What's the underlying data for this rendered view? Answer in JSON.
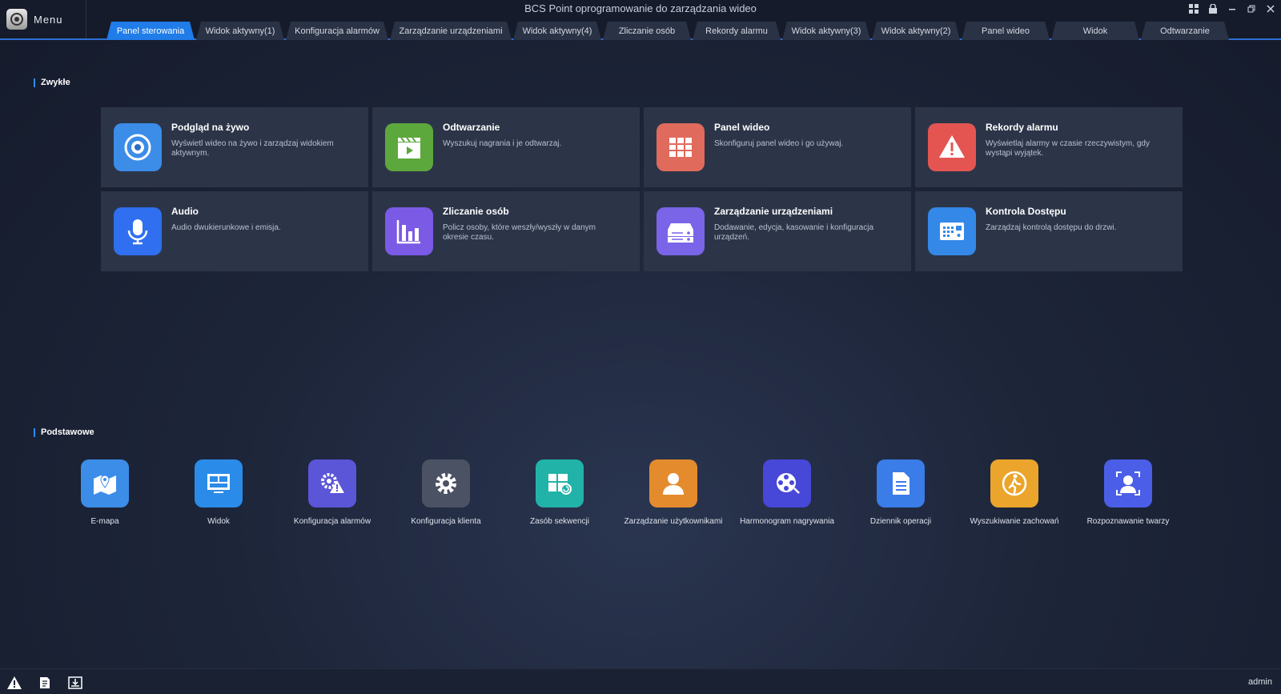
{
  "window": {
    "title": "BCS Point oprogramowanie do zarządzania wideo",
    "menu_label": "Menu",
    "controls": [
      "layout-icon",
      "lock-icon",
      "minimize-icon",
      "restore-icon",
      "close-icon"
    ]
  },
  "tabs": [
    {
      "label": "Panel sterowania",
      "active": true
    },
    {
      "label": "Widok aktywny(1)"
    },
    {
      "label": "Konfiguracja alarmów"
    },
    {
      "label": "Zarządzanie urządzeniami"
    },
    {
      "label": "Widok aktywny(4)"
    },
    {
      "label": "Zliczanie osób"
    },
    {
      "label": "Rekordy alarmu"
    },
    {
      "label": "Widok aktywny(3)"
    },
    {
      "label": "Widok aktywny(2)"
    },
    {
      "label": "Panel wideo"
    },
    {
      "label": "Widok"
    },
    {
      "label": "Odtwarzanie"
    }
  ],
  "common": {
    "title": "Zwykłe",
    "cards": [
      {
        "title": "Podgląd na żywo",
        "desc": "Wyświetl wideo na żywo i zarządzaj widokiem aktywnym.",
        "icon": "camera-icon",
        "color": "#3b8de8"
      },
      {
        "title": "Odtwarzanie",
        "desc": "Wyszukuj nagrania i je odtwarzaj.",
        "icon": "clapper-icon",
        "color": "#5da83d"
      },
      {
        "title": "Panel wideo",
        "desc": "Skonfiguruj panel wideo i go używaj.",
        "icon": "video-wall-icon",
        "color": "#e06a5c"
      },
      {
        "title": "Rekordy alarmu",
        "desc": "Wyświetlaj alarmy w czasie rzeczywistym, gdy wystąpi wyjątek.",
        "icon": "warning-icon",
        "color": "#e45552"
      },
      {
        "title": "Audio",
        "desc": "Audio dwukierunkowe i emisja.",
        "icon": "microphone-icon",
        "color": "#2f6ff0"
      },
      {
        "title": "Zliczanie osób",
        "desc": "Policz osoby, które weszły/wyszły w danym okresie czasu.",
        "icon": "bar-chart-icon",
        "color": "#7b5ae6"
      },
      {
        "title": "Zarządzanie urządzeniami",
        "desc": "Dodawanie, edycja, kasowanie i konfiguracja urządzeń.",
        "icon": "device-icon",
        "color": "#7a64e8"
      },
      {
        "title": "Kontrola Dostępu",
        "desc": "Zarządzaj kontrolą dostępu do drzwi.",
        "icon": "access-control-icon",
        "color": "#3488e8"
      }
    ]
  },
  "basic": {
    "title": "Podstawowe",
    "items": [
      {
        "label": "E-mapa",
        "icon": "map-icon",
        "color": "#3b8de8"
      },
      {
        "label": "Widok",
        "icon": "monitor-icon",
        "color": "#2a8be8"
      },
      {
        "label": "Konfiguracja alarmów",
        "icon": "alarm-config-icon",
        "color": "#5b55d8"
      },
      {
        "label": "Konfiguracja klienta",
        "icon": "gear-icon",
        "color": "#4a5263"
      },
      {
        "label": "Zasób sekwencji",
        "icon": "sequence-icon",
        "color": "#22b3a8"
      },
      {
        "label": "Zarządzanie użytkownikami",
        "icon": "user-icon",
        "color": "#e48b2e"
      },
      {
        "label": "Harmonogram nagrywania",
        "icon": "film-reel-icon",
        "color": "#4747d8"
      },
      {
        "label": "Dziennik operacji",
        "icon": "document-icon",
        "color": "#3a7ce8"
      },
      {
        "label": "Wyszukiwanie zachowań",
        "icon": "walking-person-icon",
        "color": "#eba52c"
      },
      {
        "label": "Rozpoznawanie twarzy",
        "icon": "face-recognition-icon",
        "color": "#4a5ee8"
      }
    ]
  },
  "status": {
    "icons": [
      "alarm-status-icon",
      "log-export-icon",
      "download-icon"
    ],
    "user": "admin"
  }
}
